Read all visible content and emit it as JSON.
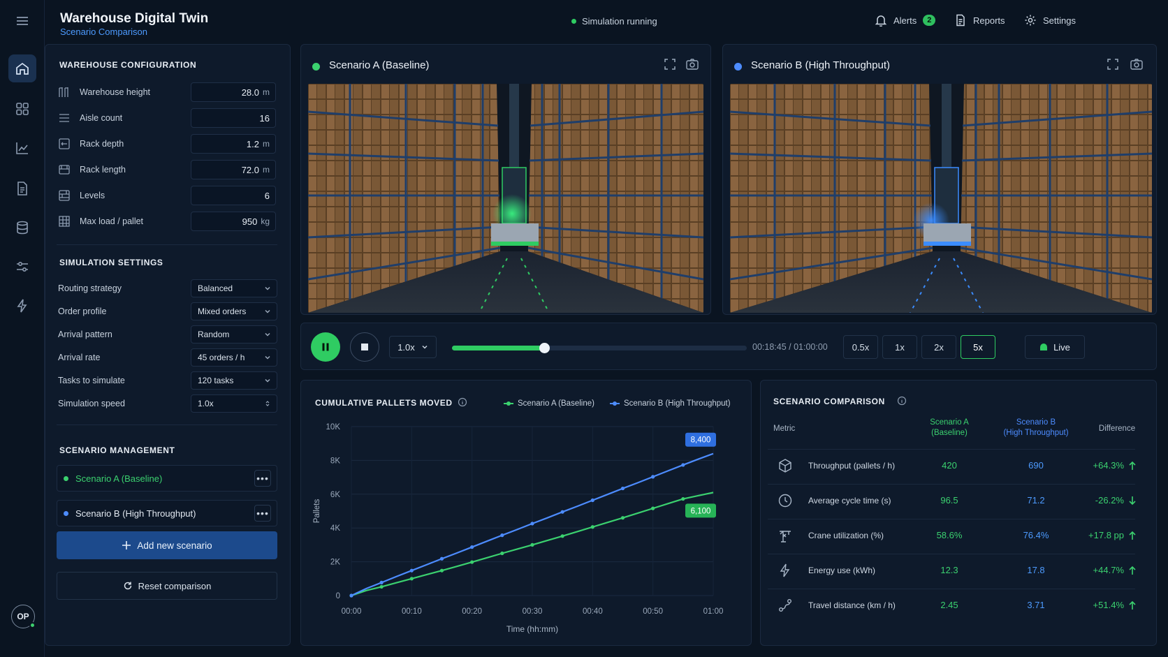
{
  "header": {
    "title": "Warehouse Digital Twin",
    "subtitle": "Scenario Comparison",
    "status": "Simulation running",
    "alerts_label": "Alerts",
    "alerts_count": "2",
    "reports_label": "Reports",
    "settings_label": "Settings"
  },
  "user": {
    "initials": "OP"
  },
  "config": {
    "title": "WAREHOUSE CONFIGURATION",
    "rows": [
      {
        "label": "Warehouse height",
        "value": "28.0",
        "unit": "m"
      },
      {
        "label": "Aisle count",
        "value": "16",
        "unit": ""
      },
      {
        "label": "Rack depth",
        "value": "1.2",
        "unit": "m"
      },
      {
        "label": "Rack length",
        "value": "72.0",
        "unit": "m"
      },
      {
        "label": "Levels",
        "value": "6",
        "unit": ""
      },
      {
        "label": "Max load / pallet",
        "value": "950",
        "unit": "kg"
      }
    ]
  },
  "sim": {
    "title": "SIMULATION SETTINGS",
    "rows": [
      {
        "label": "Routing strategy",
        "value": "Balanced"
      },
      {
        "label": "Order profile",
        "value": "Mixed orders"
      },
      {
        "label": "Arrival pattern",
        "value": "Random"
      },
      {
        "label": "Arrival rate",
        "value": "45 orders / h"
      },
      {
        "label": "Tasks to simulate",
        "value": "120 tasks"
      },
      {
        "label": "Simulation speed",
        "value": "1.0x"
      }
    ]
  },
  "scenarios": {
    "title": "SCENARIO MANAGEMENT",
    "items": [
      {
        "name": "Scenario A (Baseline)"
      },
      {
        "name": "Scenario B (High Throughput)"
      }
    ],
    "kebab": "•••",
    "add_label": "Add new scenario",
    "reset_label": "Reset comparison"
  },
  "viewports": {
    "a_title": "Scenario A (Baseline)",
    "b_title": "Scenario B (High Throughput)"
  },
  "playback": {
    "speed": "1.0x",
    "progress": 0.3125,
    "time": "00:18:45 / 01:00:00",
    "speeds": [
      "0.5x",
      "1x",
      "2x",
      "5x"
    ],
    "active_speed": "5x",
    "live_label": "Live"
  },
  "colors": {
    "a": "#3bd16f",
    "b": "#4d8cff",
    "accent": "#2fcc62"
  },
  "chart": {
    "title": "CUMULATIVE PALLETS MOVED",
    "legend_a": "Scenario A (Baseline)",
    "legend_b": "Scenario B (High Throughput)",
    "ylabel": "Pallets",
    "xlabel": "Time (hh:mm)",
    "label_b": "8,400",
    "label_a": "6,100"
  },
  "chart_data": {
    "type": "line",
    "title": "CUMULATIVE PALLETS MOVED",
    "xlabel": "Time (hh:mm)",
    "ylabel": "Pallets",
    "x_ticks": [
      "00:00",
      "00:10",
      "00:20",
      "00:30",
      "00:40",
      "00:50",
      "01:00"
    ],
    "y_ticks": [
      "0",
      "2K",
      "4K",
      "6K",
      "8K",
      "10K"
    ],
    "ylim": [
      0,
      10000
    ],
    "x": [
      0,
      2.5,
      5,
      7.5,
      10,
      12.5,
      15,
      17.5,
      20,
      22.5,
      25,
      27.5,
      30,
      32.5,
      35,
      37.5,
      40,
      42.5,
      45,
      47.5,
      50,
      52.5,
      55,
      57.5,
      60
    ],
    "series": [
      {
        "name": "Scenario A (Baseline)",
        "values": [
          0,
          300,
          520,
          760,
          1000,
          1240,
          1480,
          1730,
          1980,
          2240,
          2500,
          2750,
          3000,
          3260,
          3520,
          3790,
          4060,
          4330,
          4600,
          4880,
          5160,
          5440,
          5720,
          5910,
          6100
        ]
      },
      {
        "name": "Scenario B (High Throughput)",
        "values": [
          0,
          420,
          770,
          1130,
          1480,
          1830,
          2180,
          2520,
          2870,
          3220,
          3570,
          3910,
          4260,
          4600,
          4950,
          5290,
          5640,
          5990,
          6340,
          6680,
          7030,
          7380,
          7730,
          8070,
          8400
        ]
      }
    ],
    "annotations": [
      "8,400",
      "6,100"
    ],
    "grid": true,
    "legend": "top"
  },
  "comparison": {
    "title": "SCENARIO COMPARISON",
    "col_metric": "Metric",
    "col_a": "Scenario A",
    "col_a2": "(Baseline)",
    "col_b": "Scenario B",
    "col_b2": "(High Throughput)",
    "col_diff": "Difference",
    "rows": [
      {
        "icon": "box-icon",
        "metric": "Throughput (pallets / h)",
        "a": "420",
        "b": "690",
        "diff": "+64.3%",
        "dir": "up"
      },
      {
        "icon": "clock-icon",
        "metric": "Average cycle time (s)",
        "a": "96.5",
        "b": "71.2",
        "diff": "-26.2%",
        "dir": "down"
      },
      {
        "icon": "crane-icon",
        "metric": "Crane utilization (%)",
        "a": "58.6%",
        "b": "76.4%",
        "diff": "+17.8 pp",
        "dir": "up"
      },
      {
        "icon": "lightning-icon",
        "metric": "Energy use (kWh)",
        "a": "12.3",
        "b": "17.8",
        "diff": "+44.7%",
        "dir": "up"
      },
      {
        "icon": "route-icon",
        "metric": "Travel distance (km / h)",
        "a": "2.45",
        "b": "3.71",
        "diff": "+51.4%",
        "dir": "up"
      }
    ]
  }
}
